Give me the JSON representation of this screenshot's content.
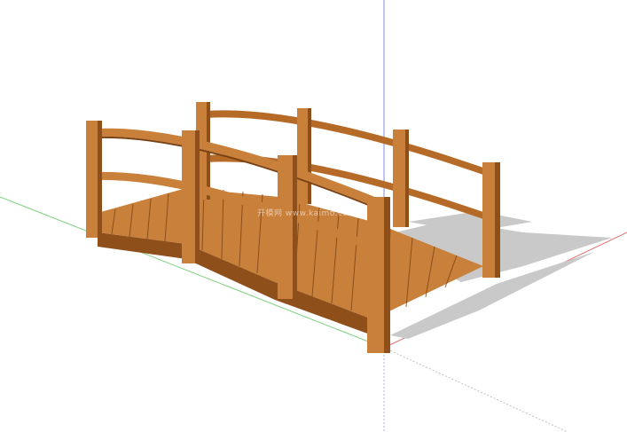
{
  "viewport": {
    "model": "arched wooden footbridge",
    "axes": {
      "red_color": "#e07070",
      "green_color": "#7ad17a",
      "blue_color": "#8a8ae0"
    },
    "colors": {
      "wood_light": "#c9803a",
      "wood_mid": "#b56a27",
      "wood_dark": "#8e4f1a",
      "plank_line": "#7a4214",
      "shadow": "#c9c9c9",
      "background": "#ffffff"
    }
  },
  "watermark": {
    "text": "开模网  www.kaimo.com"
  }
}
